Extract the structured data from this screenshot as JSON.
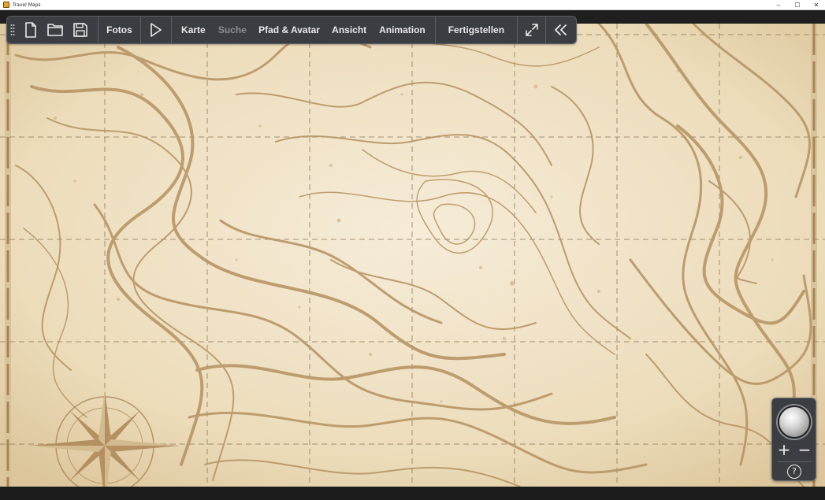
{
  "window": {
    "title": "Travel Maps",
    "controls": {
      "minimize": "–",
      "maximize": "☐",
      "close": "✕"
    }
  },
  "toolbar": {
    "icons": [
      "grip-icon",
      "new-file-icon",
      "open-folder-icon",
      "save-icon",
      "play-icon",
      "fullscreen-icon",
      "collapse-icon"
    ],
    "fotos": "Fotos",
    "karte": "Karte",
    "suche": "Suche",
    "pfad": "Pfad & Avatar",
    "ansicht": "Ansicht",
    "animation": "Animation",
    "fertigstellen": "Fertigstellen"
  },
  "zoom": {
    "plus": "+",
    "minus": "−",
    "help": "?"
  },
  "colors": {
    "map_background": "#efe2c6",
    "contour": "#b89565",
    "toolbar_bg": "#3a3d42",
    "disabled_text": "#8a8d91"
  }
}
